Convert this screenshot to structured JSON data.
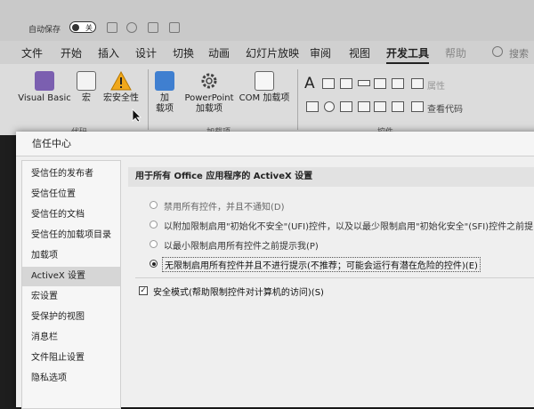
{
  "quick_access": {
    "autosave_label": "自动保存",
    "autosave_state": "关"
  },
  "tabs": [
    {
      "label": "文件"
    },
    {
      "label": "开始"
    },
    {
      "label": "插入"
    },
    {
      "label": "设计"
    },
    {
      "label": "切换"
    },
    {
      "label": "动画"
    },
    {
      "label": "幻灯片放映"
    },
    {
      "label": "审阅"
    },
    {
      "label": "视图"
    },
    {
      "label": "开发工具"
    },
    {
      "label": "帮助"
    }
  ],
  "active_tab": "开发工具",
  "search": {
    "label": "搜索"
  },
  "ribbon": {
    "code_group": {
      "label": "代码",
      "buttons": {
        "visual_basic": "Visual Basic",
        "macro": "宏",
        "macro_security": "宏安全性"
      }
    },
    "addins_group": {
      "label": "加载项",
      "buttons": {
        "addins_line1": "加",
        "addins_line2": "载项",
        "ppt_addins_line1": "PowerPoint",
        "ppt_addins_line2": "加载项",
        "com_addins": "COM 加载项"
      }
    },
    "controls_group": {
      "label": "控件",
      "properties": "属性",
      "view_code": "查看代码"
    }
  },
  "dialog": {
    "title": "信任中心",
    "nav": [
      "受信任的发布者",
      "受信任位置",
      "受信任的文档",
      "受信任的加载项目录",
      "加载项",
      "ActiveX 设置",
      "宏设置",
      "受保护的视图",
      "消息栏",
      "文件阻止设置",
      "隐私选项"
    ],
    "selected_nav": "ActiveX 设置",
    "section_header": "用于所有 Office 应用程序的 ActiveX 设置",
    "options": [
      "禁用所有控件，并且不通知(D)",
      "以附加限制启用\"初始化不安全\"(UFI)控件，以及以最少限制启用\"初始化安全\"(SFI)控件之前提",
      "以最小限制启用所有控件之前提示我(P)",
      "无限制启用所有控件并且不进行提示(不推荐；可能会运行有潜在危险的控件)(E)"
    ],
    "selected_option": 3,
    "safe_mode_label": "安全模式(帮助限制控件对计算机的访问)(S)",
    "safe_mode_checked": true
  }
}
